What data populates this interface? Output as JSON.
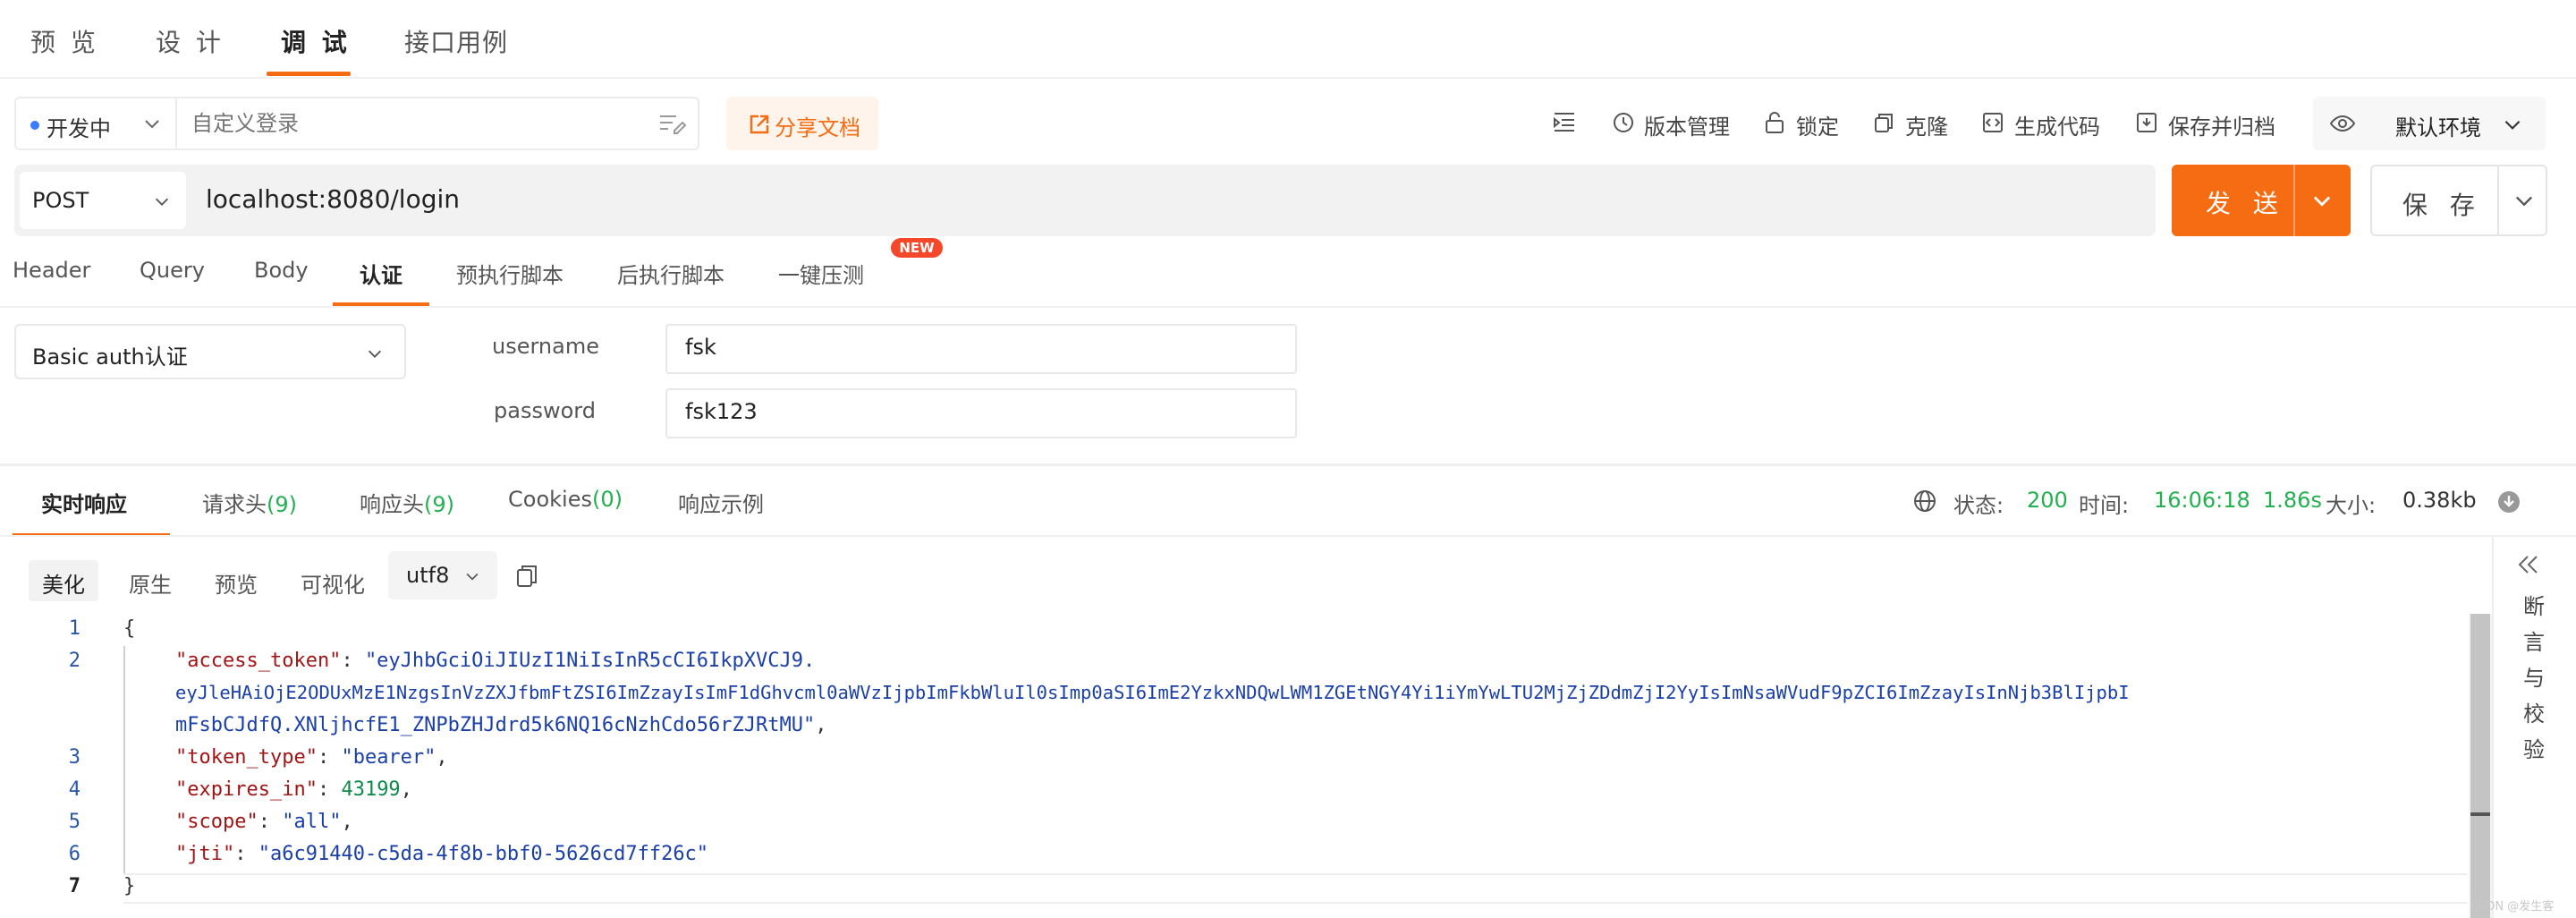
{
  "top_tabs": [
    "预 览",
    "设 计",
    "调 试",
    "接口用例"
  ],
  "toolbar": {
    "status": "开发中",
    "login_placeholder": "自定义登录",
    "share": "分享文档",
    "version": "版本管理",
    "lock": "锁定",
    "clone": "克隆",
    "gen_code": "生成代码",
    "save_archive": "保存并归档",
    "env": "默认环境"
  },
  "request": {
    "method": "POST",
    "url": "localhost:8080/login",
    "send": "发 送",
    "save": "保 存",
    "tabs": [
      "Header",
      "Query",
      "Body",
      "认证",
      "预执行脚本",
      "后执行脚本",
      "一键压测"
    ],
    "new_badge": "NEW"
  },
  "auth": {
    "type": "Basic auth认证",
    "username_label": "username",
    "username_value": "fsk",
    "password_label": "password",
    "password_value": "fsk123"
  },
  "response": {
    "tabs": {
      "realtime": "实时响应",
      "req_headers": "请求头",
      "req_headers_count": "(9)",
      "resp_headers": "响应头",
      "resp_headers_count": "(9)",
      "cookies": "Cookies",
      "cookies_count": "(0)",
      "example": "响应示例"
    },
    "meta": {
      "status_label": "状态:",
      "status": "200",
      "time_label": "时间:",
      "time": "16:06:18",
      "duration": "1.86s",
      "size_label": "大小:",
      "size": "0.38kb"
    },
    "view_tabs": [
      "美化",
      "原生",
      "预览",
      "可视化"
    ],
    "encoding": "utf8",
    "side_panel": "断言与校验",
    "line_numbers": [
      "1",
      "2",
      "3",
      "4",
      "5",
      "6",
      "7"
    ],
    "code": {
      "open": "{",
      "access_token_key": "\"access_token\"",
      "access_token_val_1": "\"eyJhbGciOiJIUzI1NiIsInR5cCI6IkpXVCJ9.",
      "access_token_val_2": "eyJleHAiOjE2ODUxMzE1NzgsInVzZXJfbmFtZSI6ImZzayIsImF1dGhvcml0aWVzIjpbImFkbWluIl0sImp0aSI6ImE2YzkxNDQwLWM1ZGEtNGY4Yi1iYmYwLTU2MjZjZDdmZjI2YyIsImNsaWVudF9pZCI6ImZzayIsInNjb3BlIjpbI",
      "access_token_val_3": "mFsbCJdfQ.XNljhcfE1_ZNPbZHJdrd5k6NQ16cNzhCdo56rZJRtMU\"",
      "token_type_key": "\"token_type\"",
      "token_type_val": "\"bearer\"",
      "expires_in_key": "\"expires_in\"",
      "expires_in_val": "43199",
      "scope_key": "\"scope\"",
      "scope_val": "\"all\"",
      "jti_key": "\"jti\"",
      "jti_val": "\"a6c91440-c5da-4f8b-bbf0-5626cd7ff26c\"",
      "close": "}"
    }
  },
  "watermark": "CSDN @发生客"
}
